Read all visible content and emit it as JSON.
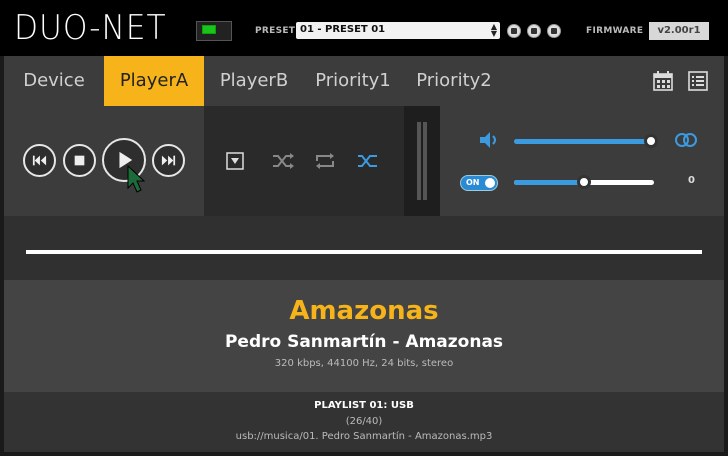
{
  "header": {
    "logo": "DUO-NET",
    "preset_label": "PRESET",
    "preset_value": "01 - PRESET 01",
    "firmware_label": "FIRMWARE",
    "firmware_value": "v2.00r1"
  },
  "tabs": [
    {
      "label": "Device",
      "active": false
    },
    {
      "label": "PlayerA",
      "active": true
    },
    {
      "label": "PlayerB",
      "active": false
    },
    {
      "label": "Priority1",
      "active": false
    },
    {
      "label": "Priority2",
      "active": false
    }
  ],
  "controls": {
    "volume_level": 0.95,
    "balance_value": "0",
    "balance_level": 0.5,
    "toggle_label": "ON"
  },
  "progress": {
    "fraction": 1.0
  },
  "track": {
    "title": "Amazonas",
    "artist_album": "Pedro Sanmartín - Amazonas",
    "format": "320 kbps, 44100 Hz, 24 bits, stereo"
  },
  "playlist": {
    "name": "PLAYLIST 01: USB",
    "position": "(26/40)",
    "path": "usb://musica/01. Pedro Sanmartín - Amazonas.mp3"
  },
  "colors": {
    "accent": "#f6b41a",
    "blue": "#2a8ad4"
  }
}
